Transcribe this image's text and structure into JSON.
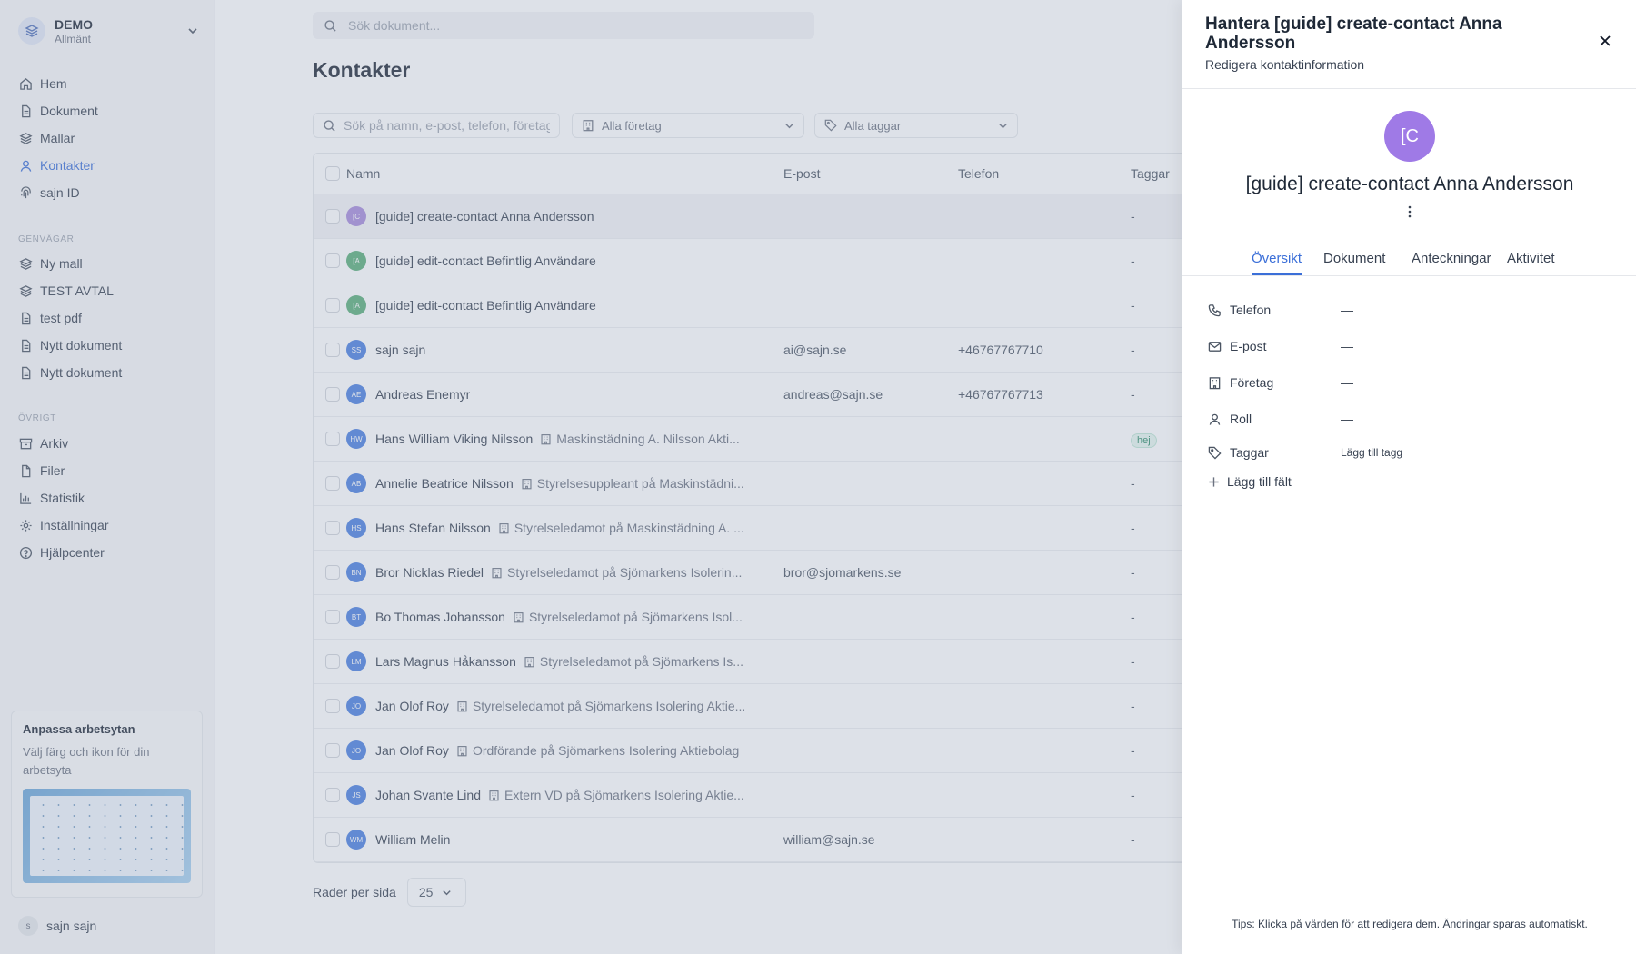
{
  "workspace": {
    "name": "DEMO",
    "sub": "Allmänt"
  },
  "nav": [
    {
      "label": "Hem",
      "icon": "home-icon"
    },
    {
      "label": "Dokument",
      "icon": "document-icon"
    },
    {
      "label": "Mallar",
      "icon": "layers-icon"
    },
    {
      "label": "Kontakter",
      "icon": "contacts-icon",
      "active": true
    },
    {
      "label": "sajn ID",
      "icon": "fingerprint-icon"
    }
  ],
  "shortcuts": {
    "label": "GENVÄGAR",
    "items": [
      "Ny mall",
      "TEST AVTAL",
      "test pdf",
      "Nytt dokument",
      "Nytt dokument"
    ]
  },
  "other": {
    "label": "ÖVRIGT",
    "items": [
      "Arkiv",
      "Filer",
      "Statistik",
      "Inställningar",
      "Hjälpcenter"
    ]
  },
  "customize": {
    "title": "Anpassa arbetsytan",
    "text": "Välj färg och ikon för din arbetsyta"
  },
  "user": {
    "initial": "s",
    "name": "sajn sajn"
  },
  "search": {
    "placeholder": "Sök dokument..."
  },
  "page_title": "Kontakter",
  "filters": {
    "search_placeholder": "Sök på namn, e-post, telefon, företag...",
    "company": "Alla företag",
    "tags": "Alla taggar"
  },
  "table": {
    "columns": [
      "Namn",
      "E-post",
      "Telefon",
      "Taggar"
    ],
    "rows": [
      {
        "initials": "[C",
        "color": "#a78bdb",
        "name": "[guide] create-contact Anna Andersson",
        "company": "",
        "email": "",
        "phone": "",
        "tags": "-"
      },
      {
        "initials": "[A",
        "color": "#5aae7a",
        "name": "[guide] edit-contact Befintlig Användare",
        "company": "",
        "email": "",
        "phone": "",
        "tags": "-"
      },
      {
        "initials": "[A",
        "color": "#5aae7a",
        "name": "[guide] edit-contact Befintlig Användare",
        "company": "",
        "email": "",
        "phone": "",
        "tags": "-"
      },
      {
        "initials": "SS",
        "color": "#4a7fe0",
        "name": "sajn sajn",
        "company": "",
        "email": "ai@sajn.se",
        "phone": "+46767767710",
        "tags": "-"
      },
      {
        "initials": "AE",
        "color": "#4a7fe0",
        "name": "Andreas Enemyr",
        "company": "",
        "email": "andreas@sajn.se",
        "phone": "+46767767713",
        "tags": "-"
      },
      {
        "initials": "HW",
        "color": "#4a7fe0",
        "name": "Hans William Viking Nilsson",
        "company": "Maskinstädning A. Nilsson Akti...",
        "email": "",
        "phone": "",
        "tags": "hej"
      },
      {
        "initials": "AB",
        "color": "#4a7fe0",
        "name": "Annelie Beatrice Nilsson",
        "company": "Styrelsesuppleant på Maskinstädni...",
        "email": "",
        "phone": "",
        "tags": "-"
      },
      {
        "initials": "HS",
        "color": "#4a7fe0",
        "name": "Hans Stefan Nilsson",
        "company": "Styrelseledamot på Maskinstädning A. ...",
        "email": "",
        "phone": "",
        "tags": "-"
      },
      {
        "initials": "BN",
        "color": "#4a7fe0",
        "name": "Bror Nicklas Riedel",
        "company": "Styrelseledamot på Sjömarkens Isolerin...",
        "email": "bror@sjomarkens.se",
        "phone": "",
        "tags": "-"
      },
      {
        "initials": "BT",
        "color": "#4a7fe0",
        "name": "Bo Thomas Johansson",
        "company": "Styrelseledamot på Sjömarkens Isol...",
        "email": "",
        "phone": "",
        "tags": "-"
      },
      {
        "initials": "LM",
        "color": "#4a7fe0",
        "name": "Lars Magnus Håkansson",
        "company": "Styrelseledamot på Sjömarkens Is...",
        "email": "",
        "phone": "",
        "tags": "-"
      },
      {
        "initials": "JO",
        "color": "#4a7fe0",
        "name": "Jan Olof Roy",
        "company": "Styrelseledamot på Sjömarkens Isolering Aktie...",
        "email": "",
        "phone": "",
        "tags": "-"
      },
      {
        "initials": "JO",
        "color": "#4a7fe0",
        "name": "Jan Olof Roy",
        "company": "Ordförande på Sjömarkens Isolering Aktiebolag",
        "email": "",
        "phone": "",
        "tags": "-"
      },
      {
        "initials": "JS",
        "color": "#4a7fe0",
        "name": "Johan Svante Lind",
        "company": "Extern VD på Sjömarkens Isolering Aktie...",
        "email": "",
        "phone": "",
        "tags": "-"
      },
      {
        "initials": "WM",
        "color": "#4a7fe0",
        "name": "William Melin",
        "company": "",
        "email": "william@sajn.se",
        "phone": "",
        "tags": "-"
      }
    ]
  },
  "pagination": {
    "label": "Rader per sida",
    "value": "25"
  },
  "panel": {
    "title": "Hantera [guide] create-contact Anna Andersson",
    "subtitle": "Redigera kontaktinformation",
    "avatar_initials": "[C",
    "avatar_color": "#9f7ae6",
    "name": "[guide] create-contact Anna Andersson",
    "tabs": [
      "Översikt",
      "Dokument",
      "Anteckningar",
      "Aktivitet"
    ],
    "fields": [
      {
        "label": "Telefon",
        "value": "—",
        "icon": "phone-icon"
      },
      {
        "label": "E-post",
        "value": "—",
        "icon": "mail-icon"
      },
      {
        "label": "Företag",
        "value": "—",
        "icon": "building-icon"
      },
      {
        "label": "Roll",
        "value": "—",
        "icon": "user-icon"
      },
      {
        "label": "Taggar",
        "value": "Lägg till tagg",
        "icon": "tag-icon"
      }
    ],
    "add_field": "Lägg till fält",
    "tip": "Tips: Klicka på värden för att redigera dem. Ändringar sparas automatiskt."
  }
}
